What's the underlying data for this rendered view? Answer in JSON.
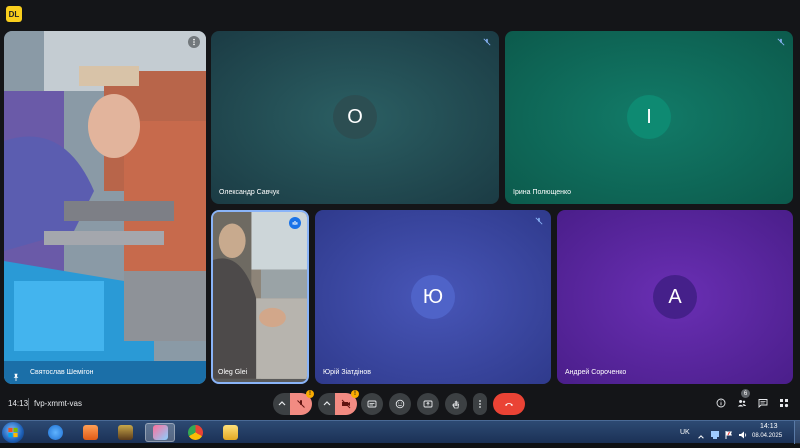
{
  "app": {
    "badge": "DL"
  },
  "tiles": [
    {
      "id": "sviatoslav",
      "name": "Святослав Шемігон",
      "type": "video"
    },
    {
      "id": "oleksandr",
      "name": "Олександр Савчук",
      "initial": "О",
      "bg": "#1f5a5e",
      "avatar_bg": "#2c4e52"
    },
    {
      "id": "iryna",
      "name": "Ірина Полющенко",
      "initial": "І",
      "bg": "#0f6a5a",
      "avatar_bg": "#0e8a72"
    },
    {
      "id": "oleg",
      "name": "Oleg Glei",
      "type": "video"
    },
    {
      "id": "yurii",
      "name": "Юрій Зіатдінов",
      "initial": "Ю",
      "bg": "#3c4aa8",
      "avatar_bg": "#4f63c8"
    },
    {
      "id": "andrei",
      "name": "Андрей Сороченко",
      "initial": "А",
      "bg": "#5a2aa0",
      "avatar_bg": "#45208a"
    }
  ],
  "controls": {
    "time": "14:13",
    "meeting_code": "fvp-xmmt-vas",
    "warn_mark": "!"
  },
  "people_count": "6",
  "taskbar": {
    "language": "UK",
    "time": "14:13",
    "date": "08.04.2025"
  },
  "colors": {
    "end_call": "#ea4335",
    "mic_off_bg": "#f28b82",
    "control_bg": "#3c4043"
  }
}
